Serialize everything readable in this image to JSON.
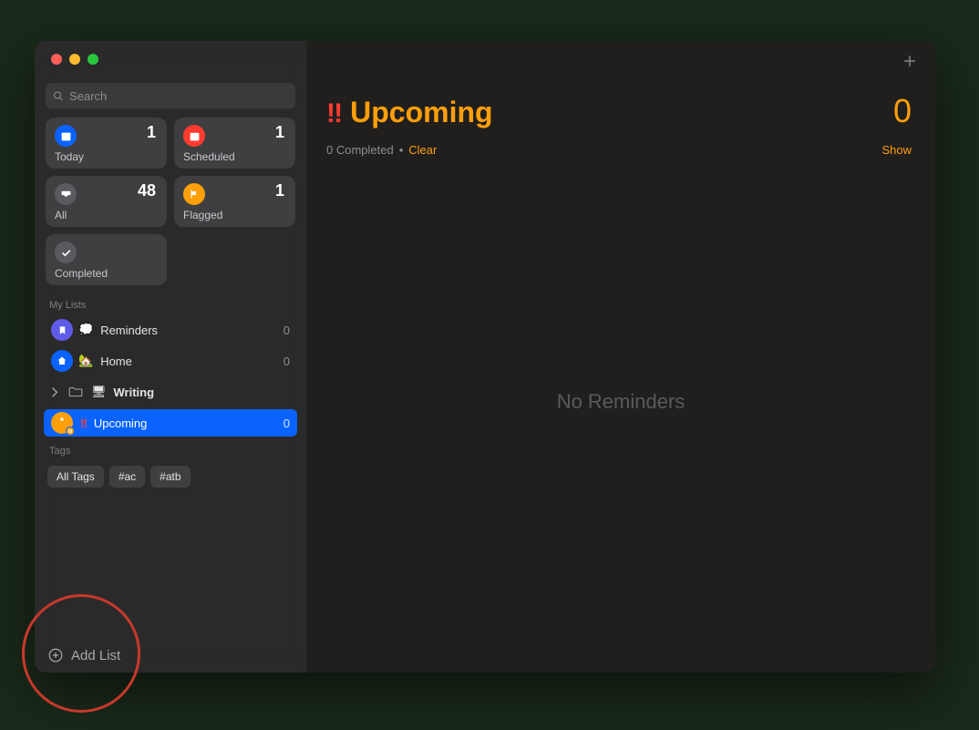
{
  "search": {
    "placeholder": "Search"
  },
  "tiles": {
    "today": {
      "label": "Today",
      "count": 1,
      "color": "#0a63ff"
    },
    "scheduled": {
      "label": "Scheduled",
      "count": 1,
      "color": "#ff3b30"
    },
    "all": {
      "label": "All",
      "count": 48,
      "color": "#5b5b5f"
    },
    "flagged": {
      "label": "Flagged",
      "count": 1,
      "color": "#ff9f0a"
    },
    "completed": {
      "label": "Completed",
      "color": "#5b5b5f"
    }
  },
  "sidebar": {
    "myListsHeader": "My Lists",
    "lists": [
      {
        "name": "Reminders",
        "count": 0,
        "color": "#5e5ce6",
        "emoji": "💭",
        "icon": "bookmark"
      },
      {
        "name": "Home",
        "count": 0,
        "color": "#0a63ff",
        "emoji": "🏡",
        "icon": "home"
      },
      {
        "name": "Writing",
        "folder": true,
        "emoji": "🖥"
      },
      {
        "name": "Upcoming",
        "count": 0,
        "color": "#ff9f0a",
        "bang": "‼",
        "selected": true,
        "smart": true
      }
    ],
    "tagsHeader": "Tags",
    "tags": [
      "All Tags",
      "#ac",
      "#atb"
    ]
  },
  "footer": {
    "addList": "Add List"
  },
  "main": {
    "bang": "‼",
    "title": "Upcoming",
    "count": 0,
    "completedText": "0 Completed",
    "clear": "Clear",
    "show": "Show",
    "empty": "No Reminders",
    "accent": "#ff9f0a"
  }
}
